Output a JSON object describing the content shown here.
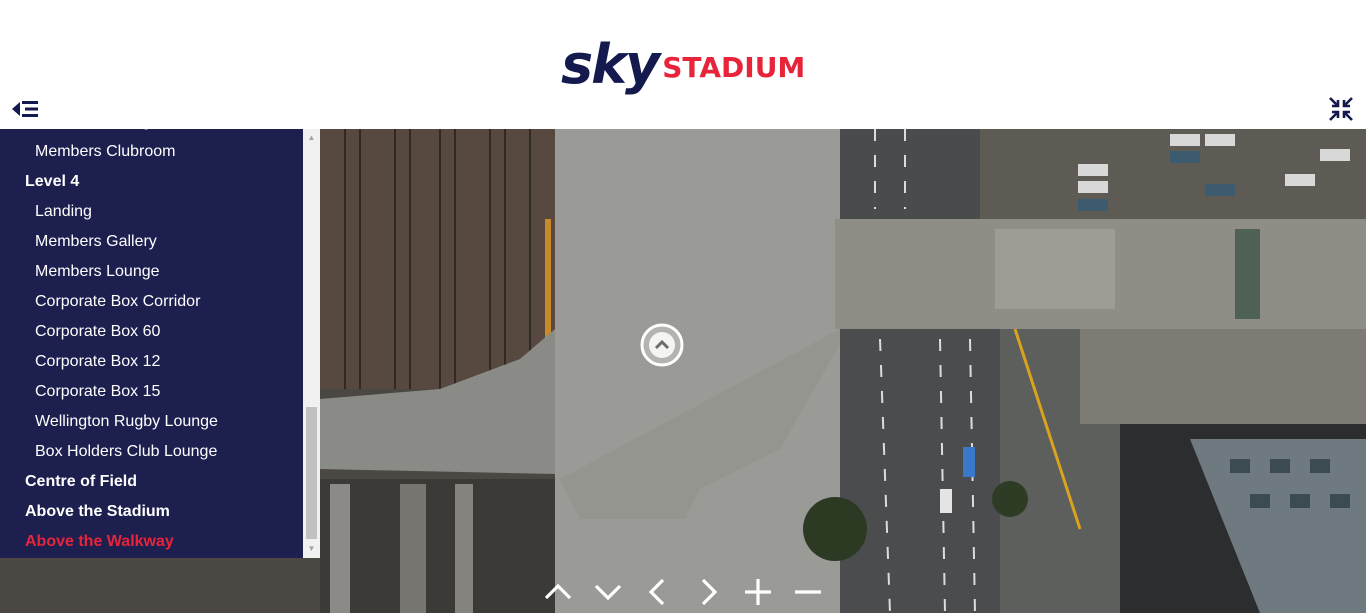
{
  "header": {
    "logo_sky": "sky",
    "logo_stadium": "STADIUM",
    "brand_navy": "#141a4e",
    "brand_red": "#e8243a"
  },
  "icons": {
    "menu_toggle": "menu-collapse-icon",
    "fullscreen": "fullscreen-icon",
    "hotspot": "chevron-up-hotspot-icon"
  },
  "menu": {
    "items": [
      {
        "label": "Members Lounge",
        "kind": "sub"
      },
      {
        "label": "Members Clubroom",
        "kind": "sub"
      },
      {
        "label": "Level 4",
        "kind": "group"
      },
      {
        "label": "Landing",
        "kind": "sub"
      },
      {
        "label": "Members Gallery",
        "kind": "sub"
      },
      {
        "label": "Members Lounge",
        "kind": "sub"
      },
      {
        "label": "Corporate Box Corridor",
        "kind": "sub"
      },
      {
        "label": "Corporate Box 60",
        "kind": "sub"
      },
      {
        "label": "Corporate Box 12",
        "kind": "sub"
      },
      {
        "label": "Corporate Box 15",
        "kind": "sub"
      },
      {
        "label": "Wellington Rugby Lounge",
        "kind": "sub"
      },
      {
        "label": "Box Holders Club Lounge",
        "kind": "sub"
      },
      {
        "label": "Centre of Field",
        "kind": "group"
      },
      {
        "label": "Above the Stadium",
        "kind": "group"
      },
      {
        "label": "Above the Walkway",
        "kind": "group",
        "active": true
      }
    ]
  },
  "nav_controls": [
    {
      "name": "tilt-up-button",
      "icon": "chevron-up-icon"
    },
    {
      "name": "tilt-down-button",
      "icon": "chevron-down-icon"
    },
    {
      "name": "pan-left-button",
      "icon": "chevron-left-icon"
    },
    {
      "name": "pan-right-button",
      "icon": "chevron-right-icon"
    },
    {
      "name": "zoom-in-button",
      "icon": "plus-icon"
    },
    {
      "name": "zoom-out-button",
      "icon": "minus-icon"
    }
  ]
}
